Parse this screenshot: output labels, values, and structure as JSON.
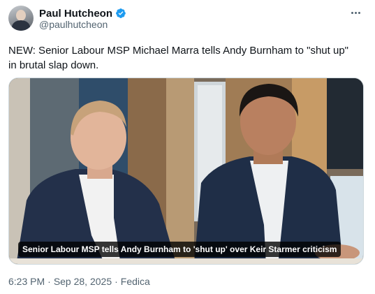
{
  "author": {
    "display_name": "Paul Hutcheon",
    "handle": "@paulhutcheon",
    "verified": true,
    "verified_color": "#1d9bf0"
  },
  "tweet": {
    "text": "NEW: Senior Labour MSP Michael Marra tells Andy Burnham to \"shut up\"\nin brutal slap down.",
    "media_caption": "Senior Labour MSP tells Andy Burnham to 'shut up' over Keir Starmer criticism"
  },
  "meta": {
    "time": "6:23 PM",
    "separator": "·",
    "date": "Sep 28, 2025",
    "client": "Fedica"
  },
  "icons": {
    "verified": "verified-badge-icon",
    "more": "more-options-icon"
  }
}
